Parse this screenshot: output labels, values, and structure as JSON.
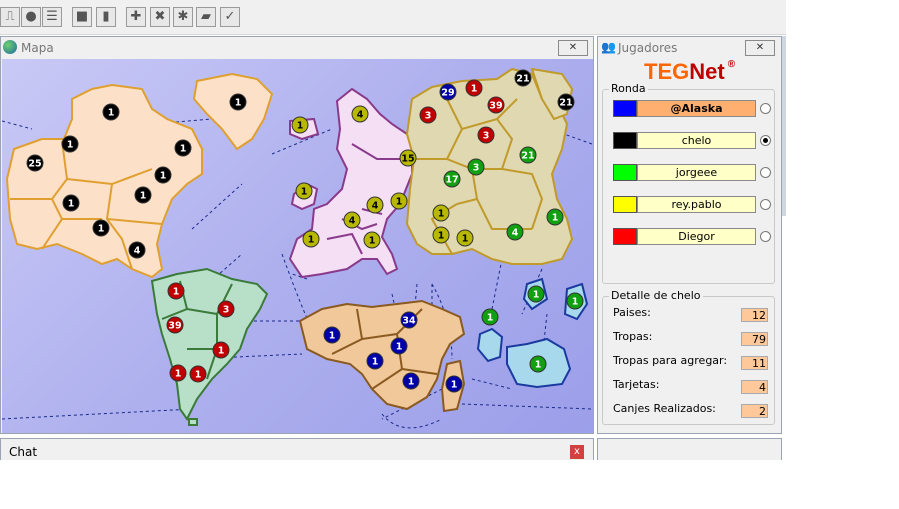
{
  "toolbar": {
    "icons": [
      "connect-icon",
      "disconnect-icon",
      "list-icon",
      "stop-icon",
      "pause-icon",
      "add-icon",
      "remove-icon",
      "settings-icon",
      "cards-icon",
      "check-icon"
    ]
  },
  "map_window": {
    "title": "Mapa",
    "close_label": "✕",
    "territories": [
      {
        "c": "black",
        "a": "1"
      },
      {
        "c": "black",
        "a": "1"
      },
      {
        "c": "black",
        "a": "25"
      },
      {
        "c": "black",
        "a": "1"
      },
      {
        "c": "black",
        "a": "1"
      },
      {
        "c": "black",
        "a": "1"
      },
      {
        "c": "black",
        "a": "1"
      },
      {
        "c": "black",
        "a": "1"
      },
      {
        "c": "black",
        "a": "1"
      },
      {
        "c": "black",
        "a": "4"
      },
      {
        "c": "red",
        "a": "1"
      },
      {
        "c": "red",
        "a": "3"
      },
      {
        "c": "red",
        "a": "39"
      },
      {
        "c": "red",
        "a": "1"
      },
      {
        "c": "red",
        "a": "1"
      },
      {
        "c": "red",
        "a": "1"
      },
      {
        "c": "yellow",
        "a": "1"
      },
      {
        "c": "yellow",
        "a": "4"
      },
      {
        "c": "yellow",
        "a": "15"
      },
      {
        "c": "yellow",
        "a": "1"
      },
      {
        "c": "yellow",
        "a": "4"
      },
      {
        "c": "yellow",
        "a": "1"
      },
      {
        "c": "yellow",
        "a": "4"
      },
      {
        "c": "yellow",
        "a": "1"
      },
      {
        "c": "yellow",
        "a": "1"
      },
      {
        "c": "yellow",
        "a": "1"
      },
      {
        "c": "yellow",
        "a": "1"
      },
      {
        "c": "yellow",
        "a": "1"
      },
      {
        "c": "blue",
        "a": "29"
      },
      {
        "c": "red",
        "a": "1"
      },
      {
        "c": "black",
        "a": "21"
      },
      {
        "c": "red",
        "a": "39"
      },
      {
        "c": "red",
        "a": "3"
      },
      {
        "c": "black",
        "a": "21"
      },
      {
        "c": "red",
        "a": "3"
      },
      {
        "c": "green",
        "a": "21"
      },
      {
        "c": "green",
        "a": "3"
      },
      {
        "c": "green",
        "a": "17"
      },
      {
        "c": "green",
        "a": "1"
      },
      {
        "c": "green",
        "a": "4"
      },
      {
        "c": "blue",
        "a": "1"
      },
      {
        "c": "blue",
        "a": "34"
      },
      {
        "c": "blue",
        "a": "1"
      },
      {
        "c": "blue",
        "a": "1"
      },
      {
        "c": "blue",
        "a": "1"
      },
      {
        "c": "blue",
        "a": "1"
      },
      {
        "c": "green",
        "a": "1"
      },
      {
        "c": "green",
        "a": "1"
      },
      {
        "c": "green",
        "a": "1"
      },
      {
        "c": "green",
        "a": "1"
      }
    ]
  },
  "players_window": {
    "title": "Jugadores",
    "close_label": "✕",
    "logo_teg": "TEG",
    "logo_net": "Net",
    "logo_mark": "®",
    "round_label": "Ronda",
    "players": [
      {
        "name": "@Alaska",
        "color": "#0000ff",
        "active": true,
        "selected": false
      },
      {
        "name": "chelo",
        "color": "#000000",
        "active": false,
        "selected": true
      },
      {
        "name": "jorgeee",
        "color": "#00ff00",
        "active": false,
        "selected": false
      },
      {
        "name": "rey.pablo",
        "color": "#ffff00",
        "active": false,
        "selected": false
      },
      {
        "name": "Diegor",
        "color": "#ff0000",
        "active": false,
        "selected": false
      }
    ],
    "detail_label": "Detalle de chelo",
    "stats": [
      {
        "label": "Paises:",
        "value": "12"
      },
      {
        "label": "Tropas:",
        "value": "79"
      },
      {
        "label": "Tropas para agregar:",
        "value": "11"
      },
      {
        "label": "Tarjetas:",
        "value": "4"
      },
      {
        "label": "Canjes Realizados:",
        "value": "2"
      }
    ]
  },
  "chat_window": {
    "title": "Chat",
    "close_label": "x"
  },
  "colors": {
    "black": "#000000",
    "red": "#c00000",
    "yellow": "#b8b800",
    "blue": "#0000a8",
    "green": "#10a010"
  }
}
